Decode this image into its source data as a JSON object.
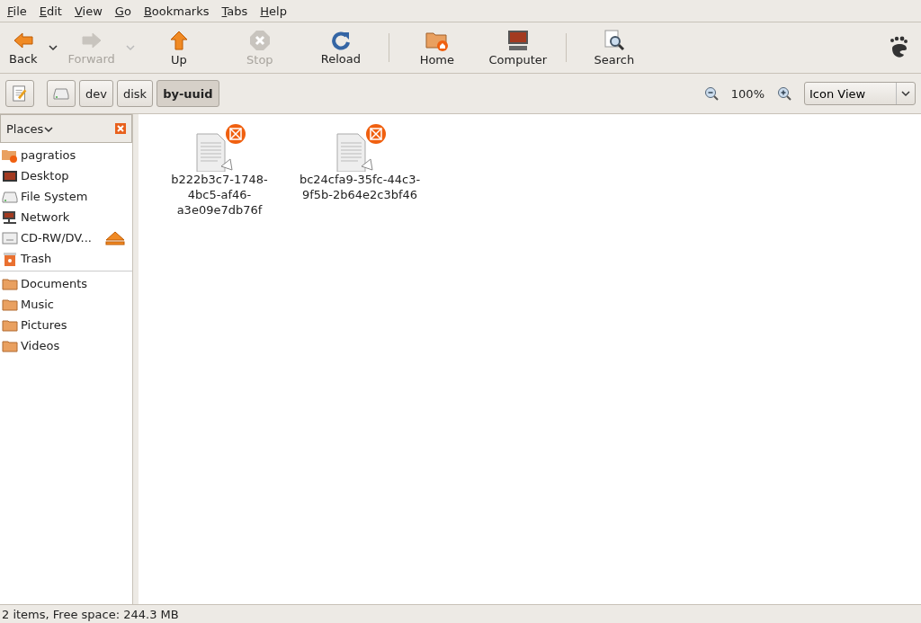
{
  "menu": [
    "File",
    "Edit",
    "View",
    "Go",
    "Bookmarks",
    "Tabs",
    "Help"
  ],
  "toolbar": [
    {
      "kind": "back",
      "label": "Back",
      "disabled": false,
      "dropdown": true
    },
    {
      "kind": "forward",
      "label": "Forward",
      "disabled": true,
      "dropdown": true
    },
    {
      "kind": "up",
      "label": "Up",
      "disabled": false,
      "dropdown": false
    },
    {
      "kind": "stop",
      "label": "Stop",
      "disabled": true,
      "dropdown": false
    },
    {
      "kind": "reload",
      "label": "Reload",
      "disabled": false,
      "dropdown": false
    },
    {
      "kind": "separator"
    },
    {
      "kind": "home",
      "label": "Home",
      "disabled": false,
      "dropdown": false
    },
    {
      "kind": "computer",
      "label": "Computer",
      "disabled": false,
      "dropdown": false
    },
    {
      "kind": "separator"
    },
    {
      "kind": "search",
      "label": "Search",
      "disabled": false,
      "dropdown": false
    }
  ],
  "path_bar": [
    {
      "kind": "drive",
      "selected": false
    },
    {
      "kind": "text",
      "label": "dev",
      "selected": false
    },
    {
      "kind": "text",
      "label": "disk",
      "selected": false
    },
    {
      "kind": "text",
      "label": "by-uuid",
      "selected": true
    }
  ],
  "zoom": {
    "level_text": "100%"
  },
  "view_select": {
    "value": "Icon View"
  },
  "sidebar": {
    "title": "Places",
    "groups": [
      [
        {
          "kind": "home",
          "label": "pagratios",
          "ejectable": false
        },
        {
          "kind": "desktop",
          "label": "Desktop",
          "ejectable": false
        },
        {
          "kind": "drive",
          "label": "File System",
          "ejectable": false
        },
        {
          "kind": "network",
          "label": "Network",
          "ejectable": false
        },
        {
          "kind": "optical",
          "label": "CD-RW/DV...",
          "ejectable": true
        },
        {
          "kind": "trash",
          "label": "Trash",
          "ejectable": false
        }
      ],
      [
        {
          "kind": "folder",
          "label": "Documents",
          "ejectable": false
        },
        {
          "kind": "folder",
          "label": "Music",
          "ejectable": false
        },
        {
          "kind": "folder",
          "label": "Pictures",
          "ejectable": false
        },
        {
          "kind": "folder",
          "label": "Videos",
          "ejectable": false
        }
      ]
    ]
  },
  "files": [
    {
      "name_lines": [
        "b222b3c7-1748-",
        "4bc5-af46-",
        "a3e09e7db76f"
      ],
      "broken": true
    },
    {
      "name_lines": [
        "bc24cfa9-35fc-44c3-",
        "9f5b-2b64e2c3bf46"
      ],
      "broken": true
    }
  ],
  "status_bar": "2 items, Free space: 244.3 MB"
}
